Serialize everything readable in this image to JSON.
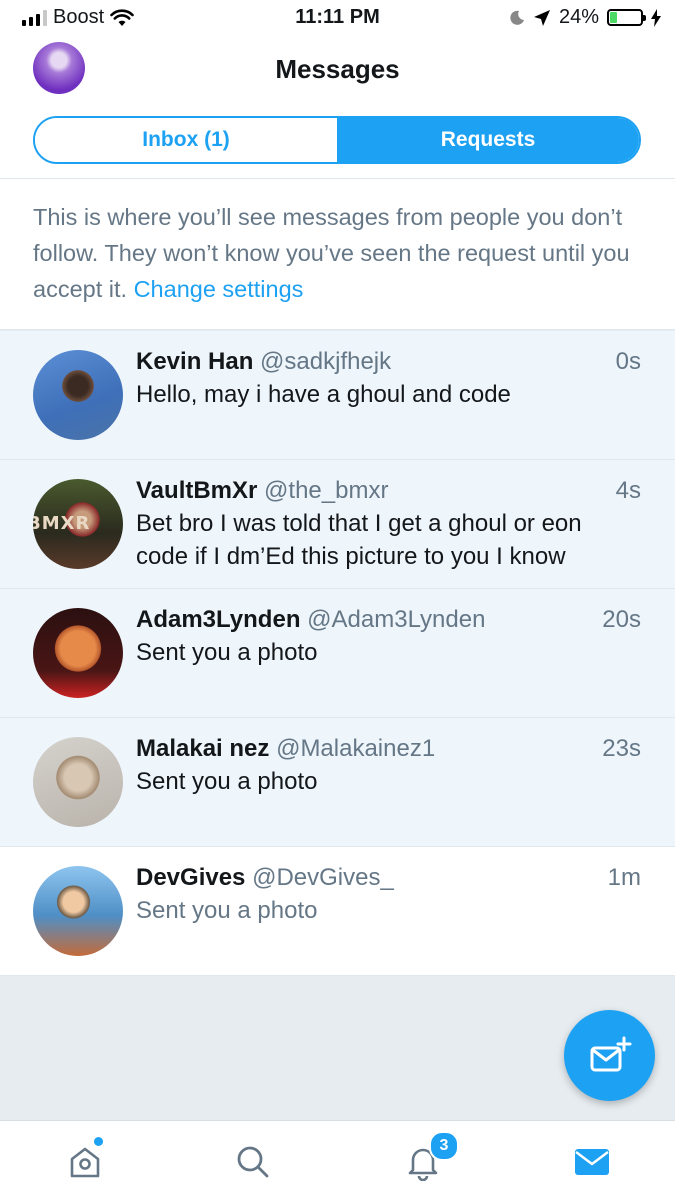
{
  "status_bar": {
    "carrier": "Boost",
    "time": "11:11 PM",
    "battery": "24%",
    "battery_level": 0.24
  },
  "header": {
    "title": "Messages",
    "tabs": [
      {
        "label": "Inbox (1)",
        "selected": false
      },
      {
        "label": "Requests",
        "selected": true
      }
    ]
  },
  "info": {
    "text": "This is where you’ll see messages from people you don’t follow. They won’t know you’ve seen the request until you accept it.",
    "link": "Change settings"
  },
  "conversations": [
    {
      "name": "Kevin Han",
      "handle": "@sadkjfhejk",
      "time": "0s",
      "message": "Hello, may i have a ghoul and code",
      "unread": true
    },
    {
      "name": "VaultBmXr",
      "handle": "@the_bmxr",
      "time": "4s",
      "message": "Bet bro I was told that I get a ghoul or eon code if I dm’Ed this picture to you I know",
      "unread": true,
      "avatar_text": "BMXR"
    },
    {
      "name": "Adam3Lynden",
      "handle": "@Adam3Lynden",
      "time": "20s",
      "message": "Sent you a photo",
      "unread": true
    },
    {
      "name": "Malakai nez",
      "handle": "@Malakainez1",
      "time": "23s",
      "message": "Sent you a photo",
      "unread": true
    },
    {
      "name": "DevGives",
      "handle": "@DevGives_",
      "time": "1m",
      "message": "Sent you a photo",
      "unread": false
    }
  ],
  "tab_bar": {
    "items": [
      {
        "icon": "home-icon",
        "has_dot": true
      },
      {
        "icon": "search-icon"
      },
      {
        "icon": "bell-icon",
        "badge": "3"
      },
      {
        "icon": "mail-icon",
        "active": true
      }
    ]
  },
  "colors": {
    "accent": "#1da1f2",
    "unread_row": "#eef5fb",
    "secondary_text": "#657786",
    "background": "#e6ecf0"
  }
}
